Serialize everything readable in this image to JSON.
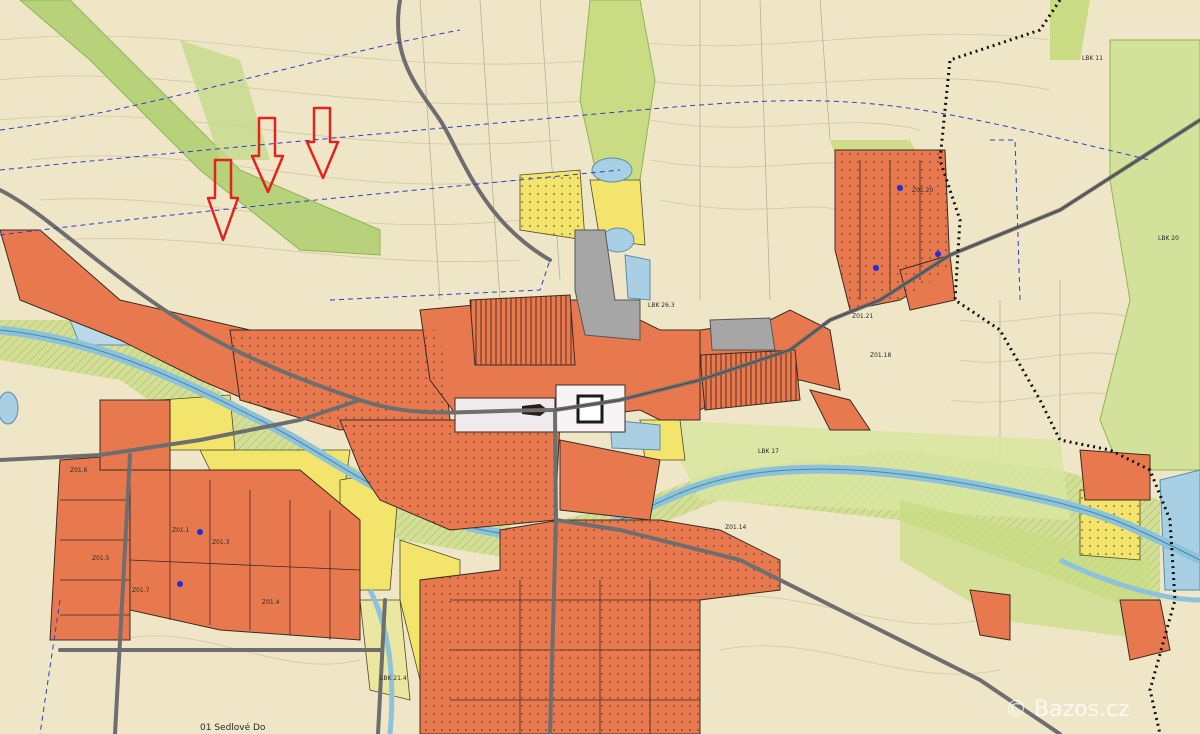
{
  "map": {
    "colors": {
      "farmland": "#efe6c8",
      "built_up": "#e8794f",
      "built_up_outline": "#3c2b22",
      "greenery": "#c9dc83",
      "green_corridor": "#9fc65a",
      "yellow_zone": "#f3e56c",
      "water": "#a8cfe3",
      "road": "#6e6e6e",
      "square": "#f1eaec",
      "industrial": "#9a9a9a",
      "boundary": "#111111",
      "arrow": "#e4231f"
    },
    "labels": {
      "z01_18": "Z01.18",
      "z01_20": "Z01.20",
      "z01_21": "Z01.21",
      "z01_14": "Z01.14",
      "z01_6": "Z01.6",
      "z01_5": "Z01.5",
      "z01_7": "Z01.7",
      "z01_4": "Z01.4",
      "z01_3": "Z01.3",
      "z01_1": "Z01.1",
      "lbk_26_3": "LBK 26.3",
      "lbk_17": "LBK 17",
      "lbk_20": "LBK 20",
      "lbk_21_4": "LBK 21.4",
      "lbk_11": "LBK 11",
      "bottom_label": "01 Sedlové Do"
    },
    "watermark": "© Bazos.cz",
    "icons": {
      "arrow": "arrow-down-icon"
    }
  }
}
